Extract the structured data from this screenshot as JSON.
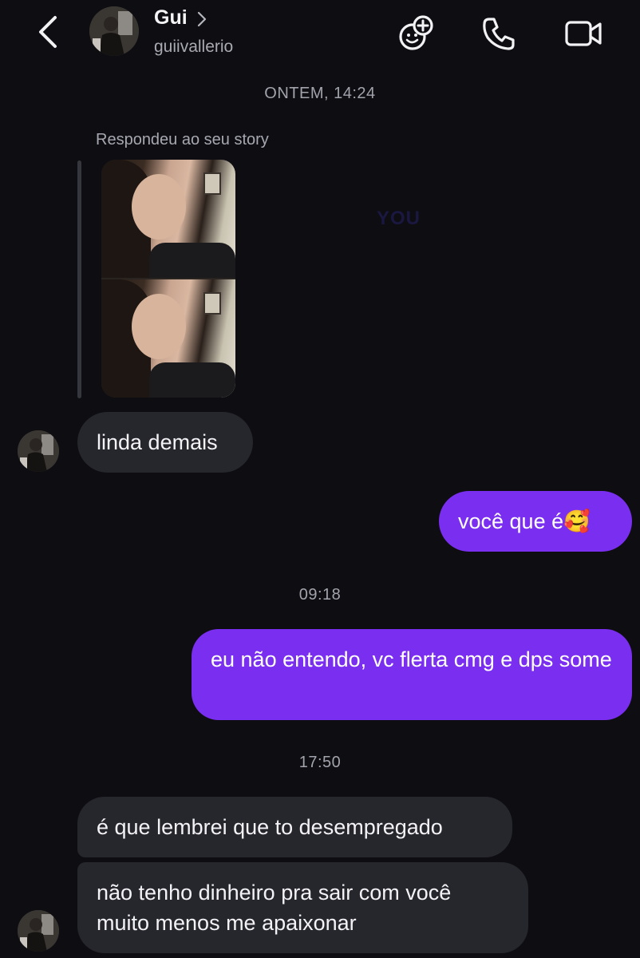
{
  "header": {
    "name": "Gui",
    "username": "guiivallerio"
  },
  "timestamps": {
    "first": "ONTEM, 14:24",
    "second": "09:18",
    "third": "17:50"
  },
  "story": {
    "caption": "Respondeu ao seu story"
  },
  "watermark": "YOU",
  "messages": {
    "m1": "linda demais",
    "m2": "você que é🥰",
    "m3": "eu não entendo, vc flerta cmg e dps some",
    "m4": "é que lembrei que to desempregado",
    "m5": "não tenho dinheiro pra sair com você muito menos me apaixonar"
  },
  "colors": {
    "background": "#0d0d12",
    "incoming_bubble": "#26262d",
    "outgoing_bubble": "#7a2ff0"
  },
  "icons": [
    "chevron-left-icon",
    "chevron-right-icon",
    "effects-add-icon",
    "phone-icon",
    "video-camera-icon"
  ]
}
